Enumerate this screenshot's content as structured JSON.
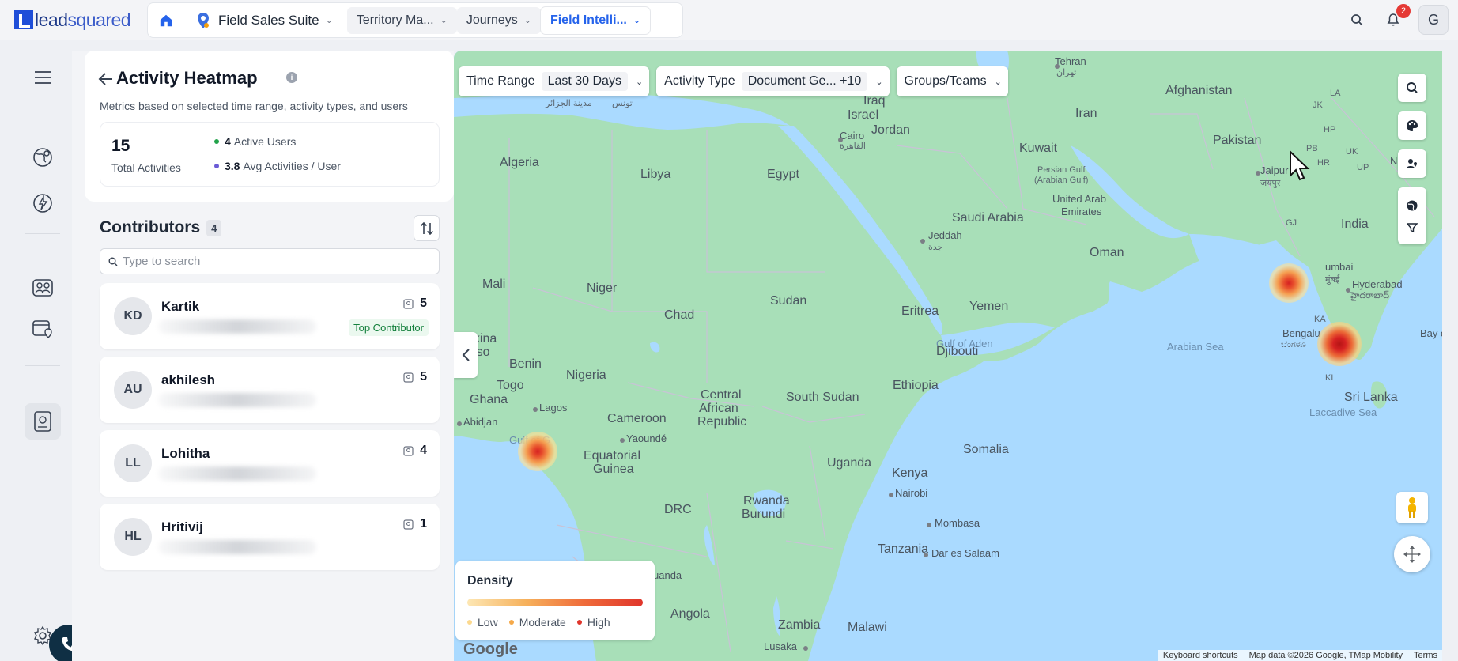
{
  "brand": {
    "logo_text_a": "lead",
    "logo_text_b": "squared"
  },
  "nav": {
    "suite": "Field Sales Suite",
    "tabs": [
      "Territory Ma...",
      "Journeys",
      "Field Intelli..."
    ],
    "notifications_count": "2",
    "user_initial": "G"
  },
  "panel": {
    "title": "Activity Heatmap",
    "subtitle": "Metrics based on selected time range, activity types, and users",
    "total_activities": "15",
    "total_activities_label": "Total Activities",
    "active_users": "4",
    "active_users_label": "Active Users",
    "avg_activities": "3.8",
    "avg_activities_label": "Avg Activities / User",
    "contributors_title": "Contributors",
    "contributors_count": "4",
    "search_placeholder": "Type to search",
    "top_contributor_tag": "Top Contributor",
    "contributors": [
      {
        "initials": "KD",
        "name": "Kartik",
        "count": "5"
      },
      {
        "initials": "AU",
        "name": "akhilesh",
        "count": "5"
      },
      {
        "initials": "LL",
        "name": "Lohitha",
        "count": "4"
      },
      {
        "initials": "HL",
        "name": "Hritivij",
        "count": "1"
      }
    ]
  },
  "filters": {
    "time_range_label": "Time Range",
    "time_range_value": "Last 30 Days",
    "activity_type_label": "Activity Type",
    "activity_type_value": "Document Ge... +10",
    "groups_label": "Groups/Teams"
  },
  "legend": {
    "title": "Density",
    "low": "Low",
    "moderate": "Moderate",
    "high": "High"
  },
  "map": {
    "labels": {
      "afghanistan": "Afghanistan",
      "iran": "Iran",
      "iraq": "Iraq",
      "israel": "Israel",
      "jordan": "Jordan",
      "kuwait": "Kuwait",
      "pakistan": "Pakistan",
      "persian_gulf": "Persian Gulf",
      "persian_gulf2": "(Arabian Gulf)",
      "uae": "United Arab",
      "uae2": "Emirates",
      "saudi": "Saudi Arabia",
      "oman": "Oman",
      "india": "India",
      "algeria": "Algeria",
      "libya": "Libya",
      "egypt": "Egypt",
      "cairo": "Cairo",
      "cairo_ar": "القاهرة",
      "jeddah": "Jeddah",
      "jeddah_ar": "جدة",
      "mali": "Mali",
      "niger": "Niger",
      "chad": "Chad",
      "sudan": "Sudan",
      "eritrea": "Eritrea",
      "yemen": "Yemen",
      "burkina": "Burkina",
      "faso": "Faso",
      "benin": "Benin",
      "togo": "Togo",
      "nigeria": "Nigeria",
      "ghana": "Ghana",
      "djibouti": "Djibouti",
      "gulf_aden": "Gulf of Aden",
      "arabian_sea": "Arabian Sea",
      "ethiopia": "Ethiopia",
      "lagos": "Lagos",
      "abidjan": "Abidjan",
      "cameroon": "Cameroon",
      "car1": "Central",
      "car2": "African",
      "car3": "Republic",
      "south_sudan": "South Sudan",
      "yaounde": "Yaoundé",
      "gulf_guinea": "Gulf of G",
      "eq_guinea1": "Equatorial",
      "eq_guinea2": "Guinea",
      "somalia": "Somalia",
      "uganda": "Uganda",
      "kenya": "Kenya",
      "nairobi": "Nairobi",
      "drc": "DRC",
      "rwanda": "Rwanda",
      "burundi": "Burundi",
      "mombasa": "Mombasa",
      "tanzania": "Tanzania",
      "dar": "Dar es Salaam",
      "angola": "Angola",
      "zambia": "Zambia",
      "malawi": "Malawi",
      "lusaka": "Lusaka",
      "luanda": "uanda",
      "tehran": "Tehran",
      "tehran_ar": "تهران",
      "jaipur": "Jaipur",
      "jaipur_hi": "जयपुर",
      "mumbai": "umbai",
      "mumbai_mr": "मुंबई",
      "hyderabad": "Hyderabad",
      "hyderabad_te": "హైదరాబాద్",
      "bengaluru": "Bengalu",
      "bengaluru_kn": "ಬೆಂಗಳೂ",
      "sri_lanka": "Sri Lanka",
      "laccadive": "Laccadive Sea",
      "bay": "Bay o",
      "madinah": "مدينة الجزائر",
      "tunis": "تونس",
      "jk": "JK",
      "la": "LA",
      "hp": "HP",
      "pb": "PB",
      "uk": "UK",
      "hr": "HR",
      "up": "UP",
      "gj": "GJ",
      "ka": "KA",
      "kl": "KL",
      "np": "N"
    },
    "google": "Google",
    "attribution": [
      "Keyboard shortcuts",
      "Map data ©2026 Google, TMap Mobility",
      "Terms"
    ]
  },
  "colors": {
    "accent": "#2563eb",
    "land": "#a8dfb8",
    "water": "#aadaff",
    "heat_high": "#d62222"
  }
}
